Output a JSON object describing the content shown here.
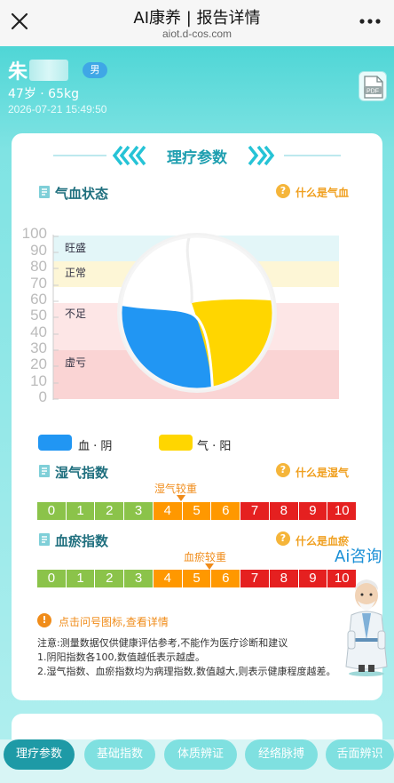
{
  "topbar": {
    "title": "AI康养 | 报告详情",
    "url": "aiot.d-cos.com"
  },
  "user": {
    "name": "朱",
    "gender": "男",
    "info": "47岁 · 65kg",
    "time": "2026-07-21 15:49:50"
  },
  "section": {
    "title": "理疗参数"
  },
  "qixue": {
    "title": "气血状态",
    "help": "什么是气血",
    "bands": [
      "旺盛",
      "正常",
      "不足",
      "虚亏"
    ],
    "legend": [
      {
        "label": "血 · 阴",
        "color": "#2196f3"
      },
      {
        "label": "气 · 阳",
        "color": "#ffd600"
      }
    ]
  },
  "chart_data": {
    "type": "pie",
    "ylim": [
      0,
      100
    ],
    "yticks": [
      "100",
      "90",
      "80",
      "70",
      "60",
      "50",
      "40",
      "30",
      "20",
      "10",
      "0"
    ],
    "bands": [
      {
        "label": "旺盛",
        "range": [
          85,
          100
        ],
        "color": "#e3f6f8"
      },
      {
        "label": "正常",
        "range": [
          70,
          85
        ],
        "color": "#fdf6d6"
      },
      {
        "label": "不足",
        "range": [
          30,
          60
        ],
        "color": "#fde6e6"
      },
      {
        "label": "虚亏",
        "range": [
          0,
          30
        ],
        "color": "#fad4d4"
      }
    ],
    "series": [
      {
        "name": "血 · 阴",
        "color": "#2196f3"
      },
      {
        "name": "气 · 阳",
        "color": "#ffd600"
      }
    ]
  },
  "shiqi": {
    "title": "湿气指数",
    "help": "什么是湿气",
    "marker": "湿气较重",
    "marker_value": 5
  },
  "xueyu": {
    "title": "血瘀指数",
    "help": "什么是血瘀",
    "marker": "血瘀较重",
    "marker_value": 5
  },
  "scale": {
    "values": [
      "0",
      "1",
      "2",
      "3",
      "4",
      "5",
      "6",
      "7",
      "8",
      "9",
      "10"
    ],
    "colors": [
      "#8bc34a",
      "#8bc34a",
      "#8bc34a",
      "#8bc34a",
      "#ff9800",
      "#ff9800",
      "#ff9800",
      "#e52020",
      "#e52020",
      "#e52020",
      "#e52020"
    ]
  },
  "note": {
    "head": "点击问号图标,查看详情",
    "lines": [
      "注意:测量数据仅供健康评估参考,不能作为医疗诊断和建议",
      "1.阴阳指数各100,数值越低表示越虚。",
      "2.湿气指数、血瘀指数均为病理指数,数值越大,则表示健康程度越差。"
    ]
  },
  "ai": {
    "label": "Ai咨询"
  },
  "tabs": [
    "理疗参数",
    "基础指数",
    "体质辨证",
    "经络脉搏",
    "舌面辨识"
  ]
}
